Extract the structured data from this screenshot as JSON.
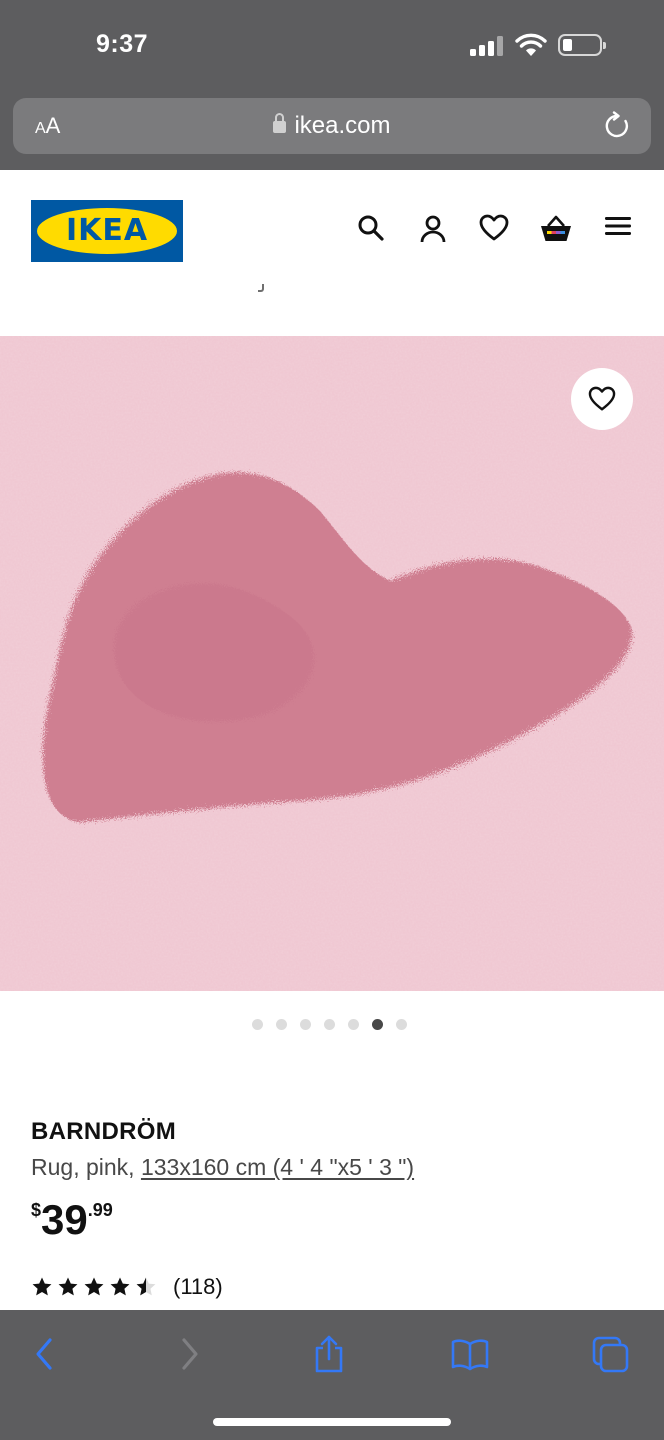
{
  "status_bar": {
    "time": "9:37",
    "battery_level": 0.2
  },
  "browser": {
    "text_size_label_small": "A",
    "text_size_label_large": "A",
    "url": "ikea.com",
    "icons": [
      "lock-icon",
      "reload-icon",
      "back-icon",
      "forward-icon",
      "share-icon",
      "bookmarks-icon",
      "tabs-icon"
    ]
  },
  "header": {
    "logo_text": "IKEA",
    "icons": [
      "search-icon",
      "user-icon",
      "wishlist-heart-icon",
      "cart-icon",
      "menu-icon"
    ]
  },
  "gallery": {
    "image_count": 7,
    "active_index": 5
  },
  "product": {
    "name": "BARNDRÖM",
    "description_prefix": "Rug, pink, ",
    "size_text": "133x160 cm (4 ' 4 \"x5 ' 3 \")",
    "price_currency": "$",
    "price_integer": "39",
    "price_decimals": ".99",
    "rating": 4.5,
    "rating_max": 5,
    "review_count": "(118)"
  },
  "colors": {
    "ikea_blue": "#0058a3",
    "ikea_yellow": "#ffdb00",
    "browser_chrome": "#5d5d5f",
    "ios_link_blue": "#3478f6",
    "rug_pink": "#eec3cf",
    "heart_pink": "#cf7f91"
  }
}
